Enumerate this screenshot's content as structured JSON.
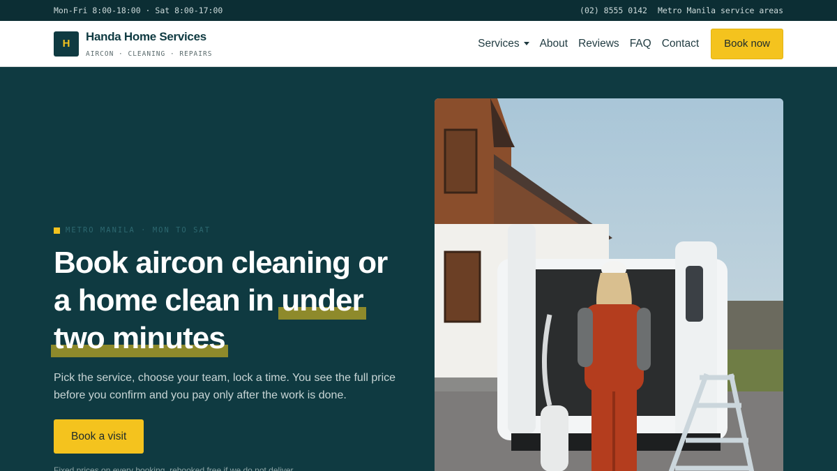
{
  "topbar": {
    "hours": "Mon-Fri 8:00-18:00 · Sat 8:00-17:00",
    "phone": "(02) 8555 0142",
    "area": "Metro Manila service areas"
  },
  "brand": {
    "logo_letter": "H",
    "name": "Handa Home Services",
    "tagline": "AIRCON · CLEANING · REPAIRS"
  },
  "nav": {
    "items": [
      {
        "label": "Services",
        "dropdown": true
      },
      {
        "label": "About"
      },
      {
        "label": "Reviews"
      },
      {
        "label": "FAQ"
      },
      {
        "label": "Contact"
      }
    ],
    "cta_label": "Book now"
  },
  "hero": {
    "eyebrow": "METRO MANILA · MON TO SAT",
    "headline_line1": "Book aircon cleaning or",
    "headline_line2_pre": "a home clean in ",
    "headline_highlight1": "under",
    "headline_highlight2": "two minutes",
    "subtext": "Pick the service, choose your team, lock a time. You see the full price before you confirm and you pay only after the work is done.",
    "cta_label": "Book a visit",
    "footnote": "Fixed prices on every booking, rebooked free if we do not deliver."
  },
  "colors": {
    "accent": "#f4c31e",
    "hero_bg": "#0f3a41",
    "topbar_bg": "#0c2e34"
  }
}
